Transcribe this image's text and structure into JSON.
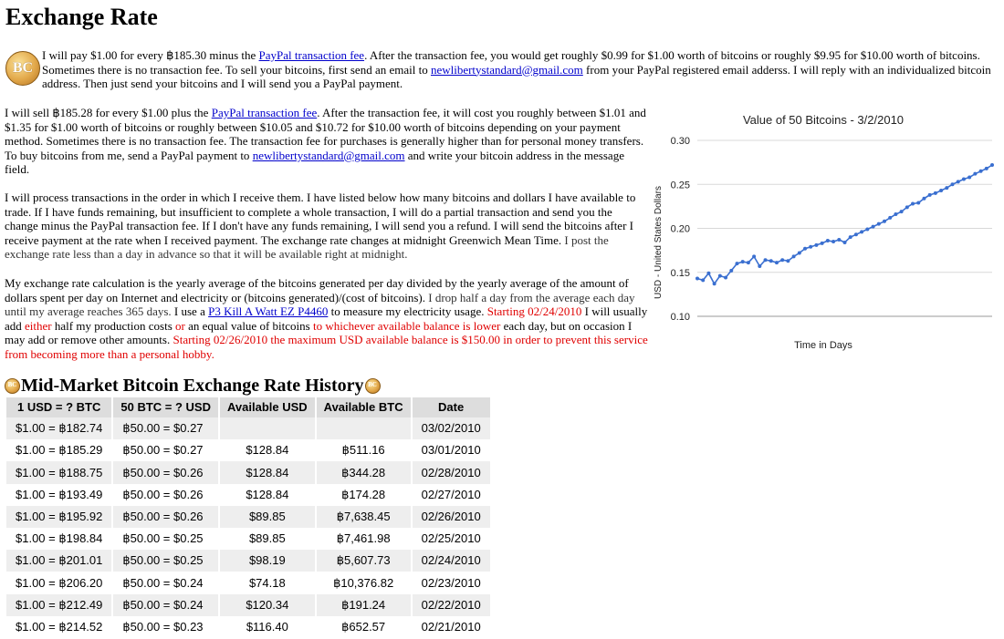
{
  "page_title": "Exchange Rate",
  "logo_text": "BC",
  "intro": {
    "t1": "I will pay $1.00 for every ฿185.30 minus the ",
    "link1": "PayPal transaction fee",
    "t2": ". After the transaction fee, you would get roughly $0.99 for $1.00 worth of bitcoins or roughly $9.95 for $10.00 worth of bitcoins. Sometimes there is no transaction fee. To sell your bitcoins, first send an email to ",
    "link2": "newlibertystandard@gmail.com",
    "t3": " from your PayPal registered email adderss. I will reply with an individualized bitcoin address. Then just send your bitcoins and I will send you a PayPal payment."
  },
  "sell": {
    "t1": "I will sell ฿185.28 for every $1.00 plus the ",
    "link1": "PayPal transaction fee",
    "t2": ". After the transaction fee, it will cost you roughly between $1.01 and $1.35 for $1.00 worth of bitcoins or roughly between $10.05 and $10.72 for $10.00 worth of bitcoins depending on your payment method. Sometimes there is no transaction fee. The transaction fee for purchases is generally higher than for personal money transfers. To buy bitcoins from me, send a PayPal payment to ",
    "link2": "newlibertystandard@gmail.com",
    "t3": " and write your bitcoin address in the message field."
  },
  "order": {
    "t1": "I will process transactions in the order in which I receive them. I have listed below how many bitcoins and dollars I have available to trade. If I have funds remaining, but insufficient to complete a whole transaction, I will do a partial transaction and send you the change minus the PayPal transaction fee. If I don't have any funds remaining, I will send you a refund. I will send the bitcoins after I receive payment at the rate when I received payment. The exchange rate changes at midnight Greenwich Mean Time. ",
    "t2": "I post the exchange rate less than a day in advance so that it will be available right at midnight."
  },
  "calc": {
    "t1": "My exchange rate calculation is the yearly average of the bitcoins generated per day divided by the yearly average of the amount of dollars spent per day on Internet and electricity or (bitcoins generated)/(cost of bitcoins). ",
    "t2": "I drop half a day from the average each day until my average reaches 365 days.",
    "t3": " I use a ",
    "link1": "P3 Kill A Watt EZ P4460",
    "t4": " to measure my electricity usage. ",
    "r1": "Starting 02/24/2010",
    "t5": " I will usually add ",
    "r2": "either",
    "t6": " half my production costs ",
    "r3": "or",
    "t7": " an equal value of bitcoins ",
    "r4": "to whichever available balance is lower",
    "t8": " each day, but on occasion I may add or remove other amounts. ",
    "r5": "Starting 02/26/2010 the maximum USD available balance is $150.00 in order to prevent this service from becoming more than a personal hobby."
  },
  "chart_data": {
    "type": "line",
    "title": "Value of 50 Bitcoins - 3/2/2010",
    "xlabel": "Time in Days",
    "ylabel": "USD - United States Dollars",
    "ylim": [
      0.1,
      0.3
    ],
    "yticks": [
      "0.10",
      "0.15",
      "0.20",
      "0.25",
      "0.30"
    ],
    "grid": true,
    "line_color": "#3a6fd0",
    "values": [
      0.143,
      0.141,
      0.149,
      0.137,
      0.146,
      0.144,
      0.152,
      0.16,
      0.162,
      0.161,
      0.168,
      0.157,
      0.164,
      0.163,
      0.161,
      0.164,
      0.163,
      0.168,
      0.172,
      0.177,
      0.179,
      0.181,
      0.183,
      0.186,
      0.185,
      0.187,
      0.184,
      0.19,
      0.193,
      0.196,
      0.199,
      0.202,
      0.205,
      0.208,
      0.212,
      0.216,
      0.219,
      0.224,
      0.228,
      0.229,
      0.234,
      0.238,
      0.24,
      0.243,
      0.246,
      0.25,
      0.253,
      0.256,
      0.258,
      0.262,
      0.265,
      0.268,
      0.272
    ]
  },
  "history": {
    "title": "Mid-Market Bitcoin Exchange Rate History",
    "headers": [
      "1 USD = ? BTC",
      "50 BTC = ? USD",
      "Available USD",
      "Available BTC",
      "Date"
    ],
    "rows": [
      [
        "$1.00 = ฿182.74",
        "฿50.00 = $0.27",
        "",
        "",
        "03/02/2010"
      ],
      [
        "$1.00 = ฿185.29",
        "฿50.00 = $0.27",
        "$128.84",
        "฿511.16",
        "03/01/2010"
      ],
      [
        "$1.00 = ฿188.75",
        "฿50.00 = $0.26",
        "$128.84",
        "฿344.28",
        "02/28/2010"
      ],
      [
        "$1.00 = ฿193.49",
        "฿50.00 = $0.26",
        "$128.84",
        "฿174.28",
        "02/27/2010"
      ],
      [
        "$1.00 = ฿195.92",
        "฿50.00 = $0.26",
        "$89.85",
        "฿7,638.45",
        "02/26/2010"
      ],
      [
        "$1.00 = ฿198.84",
        "฿50.00 = $0.25",
        "$89.85",
        "฿7,461.98",
        "02/25/2010"
      ],
      [
        "$1.00 = ฿201.01",
        "฿50.00 = $0.25",
        "$98.19",
        "฿5,607.73",
        "02/24/2010"
      ],
      [
        "$1.00 = ฿206.20",
        "฿50.00 = $0.24",
        "$74.18",
        "฿10,376.82",
        "02/23/2010"
      ],
      [
        "$1.00 = ฿212.49",
        "฿50.00 = $0.24",
        "$120.34",
        "฿191.24",
        "02/22/2010"
      ],
      [
        "$1.00 = ฿214.52",
        "฿50.00 = $0.23",
        "$116.40",
        "฿652.57",
        "02/21/2010"
      ]
    ]
  }
}
